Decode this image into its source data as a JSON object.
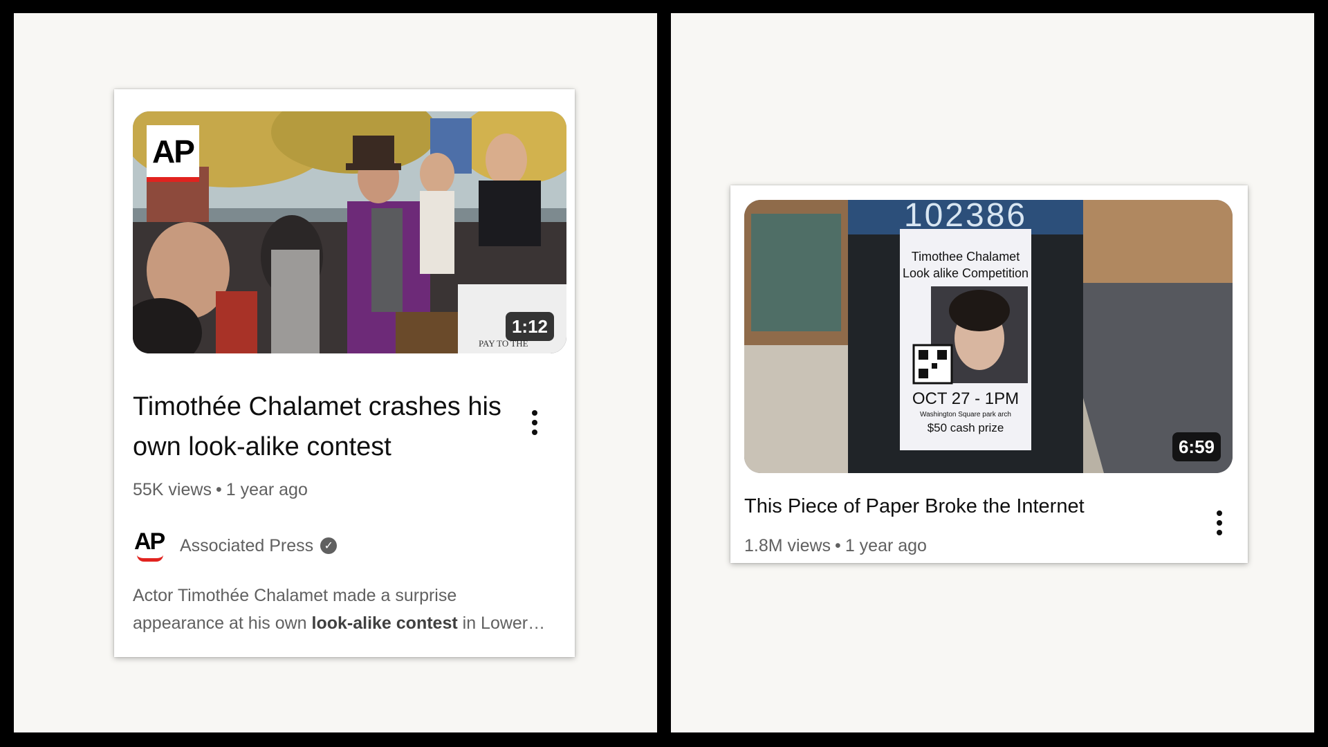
{
  "left_card": {
    "duration": "1:12",
    "logo_text": "AP",
    "title": "Timothée Chalamet crashes his own look-alike contest",
    "views": "55K views",
    "age": "1 year ago",
    "separator": "•",
    "channel": {
      "avatar_text": "AP",
      "name": "Associated Press",
      "verified_icon": "check-icon"
    },
    "description": {
      "line1": "Actor Timothée Chalamet made a surprise",
      "line2_pre": "appearance at his own ",
      "line2_bold": "look-alike contest",
      "line2_post": " in Lower…"
    },
    "thumbnail_caption": "PAY TO THE"
  },
  "right_card": {
    "duration": "6:59",
    "title": "This Piece of Paper Broke the Internet",
    "views": "1.8M views",
    "age": "1 year ago",
    "separator": "•",
    "poster": {
      "pole_number": "102386",
      "line1": "Timothee Chalamet",
      "line2": "Look alike Competition",
      "date": "OCT 27 - 1PM",
      "place": "Washington Square park arch",
      "prize": "$50 cash prize"
    }
  },
  "colors": {
    "ap_red": "#e1231f",
    "text_primary": "#0f0f0f",
    "text_secondary": "#606060",
    "backdrop": "#000000",
    "panel": "#f8f7f4"
  }
}
